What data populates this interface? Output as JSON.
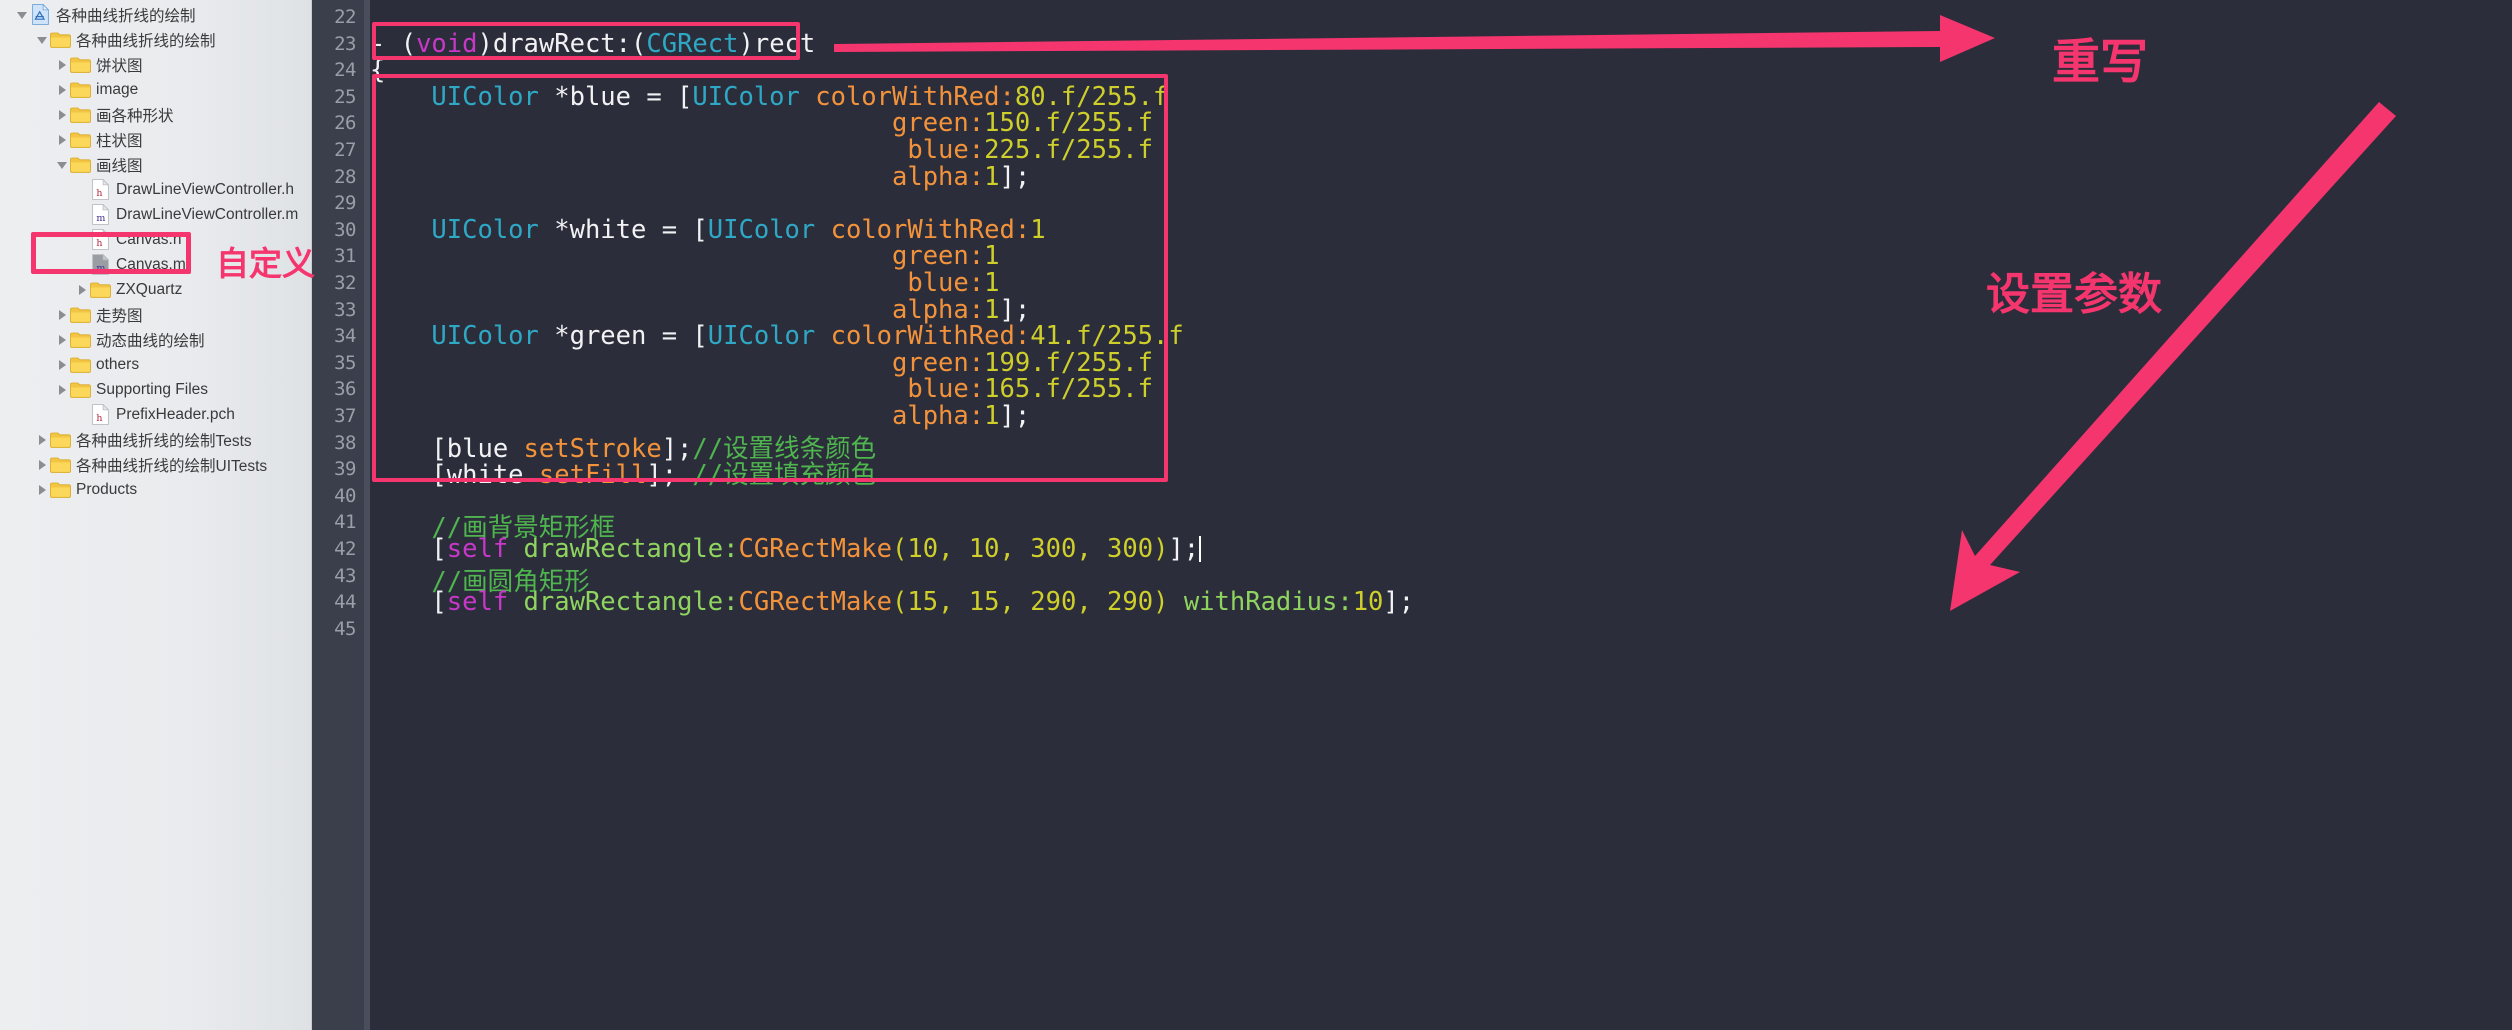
{
  "sidebar": {
    "items": [
      {
        "label": "各种曲线折线的绘制",
        "indent": 0,
        "twisty": "down",
        "icon": "xcode-project-icon"
      },
      {
        "label": "各种曲线折线的绘制",
        "indent": 1,
        "twisty": "down",
        "icon": "folder-icon"
      },
      {
        "label": "饼状图",
        "indent": 2,
        "twisty": "right",
        "icon": "folder-icon"
      },
      {
        "label": "image",
        "indent": 2,
        "twisty": "right",
        "icon": "folder-icon"
      },
      {
        "label": "画各种形状",
        "indent": 2,
        "twisty": "right",
        "icon": "folder-icon"
      },
      {
        "label": "柱状图",
        "indent": 2,
        "twisty": "right",
        "icon": "folder-icon"
      },
      {
        "label": "画线图",
        "indent": 2,
        "twisty": "down",
        "icon": "folder-icon"
      },
      {
        "label": "DrawLineViewController.h",
        "indent": 3,
        "twisty": "none",
        "icon": "header-file-icon"
      },
      {
        "label": "DrawLineViewController.m",
        "indent": 3,
        "twisty": "none",
        "icon": "impl-file-icon"
      },
      {
        "label": "Canvas.h",
        "indent": 3,
        "twisty": "none",
        "icon": "header-file-icon"
      },
      {
        "label": "Canvas.m",
        "indent": 3,
        "twisty": "none",
        "icon": "impl-file-icon-selected"
      },
      {
        "label": "ZXQuartz",
        "indent": 3,
        "twisty": "right",
        "icon": "folder-icon"
      },
      {
        "label": "走势图",
        "indent": 2,
        "twisty": "right",
        "icon": "folder-icon"
      },
      {
        "label": "动态曲线的绘制",
        "indent": 2,
        "twisty": "right",
        "icon": "folder-icon"
      },
      {
        "label": "others",
        "indent": 2,
        "twisty": "right",
        "icon": "folder-icon"
      },
      {
        "label": "Supporting Files",
        "indent": 2,
        "twisty": "right",
        "icon": "folder-icon"
      },
      {
        "label": "PrefixHeader.pch",
        "indent": 3,
        "twisty": "none",
        "icon": "header-file-icon"
      },
      {
        "label": "各种曲线折线的绘制Tests",
        "indent": 1,
        "twisty": "right",
        "icon": "folder-icon"
      },
      {
        "label": "各种曲线折线的绘制UITests",
        "indent": 1,
        "twisty": "right",
        "icon": "folder-icon"
      },
      {
        "label": "Products",
        "indent": 1,
        "twisty": "right",
        "icon": "folder-icon"
      }
    ]
  },
  "editor": {
    "line_numbers": [
      "22",
      "23",
      "24",
      "25",
      "26",
      "27",
      "28",
      "29",
      "30",
      "31",
      "32",
      "33",
      "34",
      "35",
      "36",
      "37",
      "38",
      "39",
      "40",
      "41",
      "42",
      "43",
      "44",
      "45"
    ],
    "lines": [
      {
        "num": "22",
        "tokens": []
      },
      {
        "num": "23",
        "tokens": [
          {
            "t": "- (",
            "c": "plain"
          },
          {
            "t": "void",
            "c": "kw"
          },
          {
            "t": ")drawRect:(",
            "c": "plain"
          },
          {
            "t": "CGRect",
            "c": "type"
          },
          {
            "t": ")rect",
            "c": "plain"
          }
        ]
      },
      {
        "num": "24",
        "tokens": [
          {
            "t": "{",
            "c": "plain"
          }
        ]
      },
      {
        "num": "25",
        "tokens": [
          {
            "t": "    ",
            "c": "plain"
          },
          {
            "t": "UIColor",
            "c": "type"
          },
          {
            "t": " *blue = [",
            "c": "plain"
          },
          {
            "t": "UIColor",
            "c": "type"
          },
          {
            "t": " ",
            "c": "plain"
          },
          {
            "t": "colorWithRed:",
            "c": "param"
          },
          {
            "t": "80.f/255.f",
            "c": "num"
          }
        ]
      },
      {
        "num": "26",
        "tokens": [
          {
            "t": "                                  ",
            "c": "plain"
          },
          {
            "t": "green:",
            "c": "param"
          },
          {
            "t": "150.f/255.f",
            "c": "num"
          }
        ]
      },
      {
        "num": "27",
        "tokens": [
          {
            "t": "                                   ",
            "c": "plain"
          },
          {
            "t": "blue:",
            "c": "param"
          },
          {
            "t": "225.f/255.f",
            "c": "num"
          }
        ]
      },
      {
        "num": "28",
        "tokens": [
          {
            "t": "                                  ",
            "c": "plain"
          },
          {
            "t": "alpha:",
            "c": "param"
          },
          {
            "t": "1",
            "c": "num"
          },
          {
            "t": "];",
            "c": "plain"
          }
        ]
      },
      {
        "num": "29",
        "tokens": []
      },
      {
        "num": "30",
        "tokens": [
          {
            "t": "    ",
            "c": "plain"
          },
          {
            "t": "UIColor",
            "c": "type"
          },
          {
            "t": " *white = [",
            "c": "plain"
          },
          {
            "t": "UIColor",
            "c": "type"
          },
          {
            "t": " ",
            "c": "plain"
          },
          {
            "t": "colorWithRed:",
            "c": "param"
          },
          {
            "t": "1",
            "c": "num"
          }
        ]
      },
      {
        "num": "31",
        "tokens": [
          {
            "t": "                                  ",
            "c": "plain"
          },
          {
            "t": "green:",
            "c": "param"
          },
          {
            "t": "1",
            "c": "num"
          }
        ]
      },
      {
        "num": "32",
        "tokens": [
          {
            "t": "                                   ",
            "c": "plain"
          },
          {
            "t": "blue:",
            "c": "param"
          },
          {
            "t": "1",
            "c": "num"
          }
        ]
      },
      {
        "num": "33",
        "tokens": [
          {
            "t": "                                  ",
            "c": "plain"
          },
          {
            "t": "alpha:",
            "c": "param"
          },
          {
            "t": "1",
            "c": "num"
          },
          {
            "t": "];",
            "c": "plain"
          }
        ]
      },
      {
        "num": "34",
        "tokens": [
          {
            "t": "    ",
            "c": "plain"
          },
          {
            "t": "UIColor",
            "c": "type"
          },
          {
            "t": " *green = [",
            "c": "plain"
          },
          {
            "t": "UIColor",
            "c": "type"
          },
          {
            "t": " ",
            "c": "plain"
          },
          {
            "t": "colorWithRed:",
            "c": "param"
          },
          {
            "t": "41.f/255.f",
            "c": "num"
          }
        ]
      },
      {
        "num": "35",
        "tokens": [
          {
            "t": "                                  ",
            "c": "plain"
          },
          {
            "t": "green:",
            "c": "param"
          },
          {
            "t": "199.f/255.f",
            "c": "num"
          }
        ]
      },
      {
        "num": "36",
        "tokens": [
          {
            "t": "                                   ",
            "c": "plain"
          },
          {
            "t": "blue:",
            "c": "param"
          },
          {
            "t": "165.f/255.f",
            "c": "num"
          }
        ]
      },
      {
        "num": "37",
        "tokens": [
          {
            "t": "                                  ",
            "c": "plain"
          },
          {
            "t": "alpha:",
            "c": "param"
          },
          {
            "t": "1",
            "c": "num"
          },
          {
            "t": "];",
            "c": "plain"
          }
        ]
      },
      {
        "num": "38",
        "tokens": [
          {
            "t": "    [blue ",
            "c": "plain"
          },
          {
            "t": "setStroke",
            "c": "param"
          },
          {
            "t": "];",
            "c": "plain"
          },
          {
            "t": "//设置线条颜色",
            "c": "cmt"
          }
        ]
      },
      {
        "num": "39",
        "tokens": [
          {
            "t": "    [white ",
            "c": "plain"
          },
          {
            "t": "setFill",
            "c": "param"
          },
          {
            "t": "]; ",
            "c": "plain"
          },
          {
            "t": "//设置填充颜色",
            "c": "cmt"
          }
        ]
      },
      {
        "num": "40",
        "tokens": []
      },
      {
        "num": "41",
        "tokens": [
          {
            "t": "    ",
            "c": "plain"
          },
          {
            "t": "//画背景矩形框",
            "c": "cmt"
          }
        ]
      },
      {
        "num": "42",
        "tokens": [
          {
            "t": "    [",
            "c": "plain"
          },
          {
            "t": "self",
            "c": "kw"
          },
          {
            "t": " ",
            "c": "plain"
          },
          {
            "t": "drawRectangle:",
            "c": "meth"
          },
          {
            "t": "CGRectMake",
            "c": "param"
          },
          {
            "t": "(",
            "c": "num"
          },
          {
            "t": "10",
            "c": "num"
          },
          {
            "t": ", ",
            "c": "num"
          },
          {
            "t": "10",
            "c": "num"
          },
          {
            "t": ", ",
            "c": "num"
          },
          {
            "t": "300",
            "c": "num"
          },
          {
            "t": ", ",
            "c": "num"
          },
          {
            "t": "300",
            "c": "num"
          },
          {
            "t": ")",
            "c": "num"
          },
          {
            "t": "];",
            "c": "plain"
          },
          {
            "t": "|CARET|",
            "c": "caret"
          }
        ]
      },
      {
        "num": "43",
        "tokens": [
          {
            "t": "    ",
            "c": "plain"
          },
          {
            "t": "//画圆角矩形",
            "c": "cmt"
          }
        ]
      },
      {
        "num": "44",
        "tokens": [
          {
            "t": "    [",
            "c": "plain"
          },
          {
            "t": "self",
            "c": "kw"
          },
          {
            "t": " ",
            "c": "plain"
          },
          {
            "t": "drawRectangle:",
            "c": "meth"
          },
          {
            "t": "CGRectMake",
            "c": "param"
          },
          {
            "t": "(",
            "c": "num"
          },
          {
            "t": "15",
            "c": "num"
          },
          {
            "t": ", ",
            "c": "num"
          },
          {
            "t": "15",
            "c": "num"
          },
          {
            "t": ", ",
            "c": "num"
          },
          {
            "t": "290",
            "c": "num"
          },
          {
            "t": ", ",
            "c": "num"
          },
          {
            "t": "290",
            "c": "num"
          },
          {
            "t": ") ",
            "c": "num"
          },
          {
            "t": "withRadius:",
            "c": "meth"
          },
          {
            "t": "10",
            "c": "num"
          },
          {
            "t": "];",
            "c": "plain"
          }
        ]
      },
      {
        "num": "45",
        "tokens": []
      }
    ]
  },
  "annotations": {
    "label_override": "重写",
    "label_set_params": "设置参数",
    "label_custom": "自定义",
    "accent_color": "#f4356e",
    "outline_color": "#ffffff"
  }
}
